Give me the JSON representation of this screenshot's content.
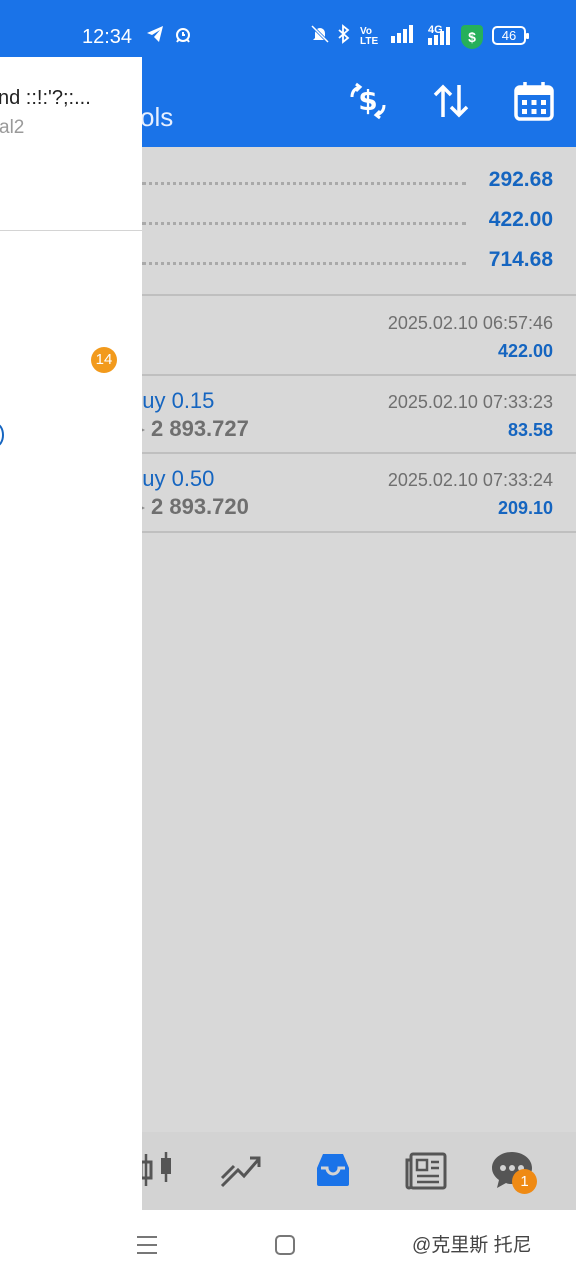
{
  "status_bar": {
    "time": "12:34",
    "network_label": "4G",
    "volte_label": "Vo LTE",
    "battery": "46",
    "shield_glyph": "$"
  },
  "header": {
    "title_fragment": "ols",
    "icons": [
      "currency-exchange-icon",
      "sort-icon",
      "calendar-icon"
    ]
  },
  "summary": {
    "rows": [
      {
        "value": "292.68"
      },
      {
        "value": "422.00"
      },
      {
        "value": "714.68"
      }
    ]
  },
  "deals": [
    {
      "title": "",
      "price": "",
      "date": "2025.02.10 06:57:46",
      "amount": "422.00"
    },
    {
      "title": "buy 0.15",
      "price": "2 893.727",
      "date": "2025.02.10 07:33:23",
      "amount": "83.58"
    },
    {
      "title": "buy 0.50",
      "price": "2 893.720",
      "date": "2025.02.10 07:33:24",
      "amount": "209.10"
    }
  ],
  "bottom_nav": {
    "items": [
      "chart-candles-icon",
      "trade-icon",
      "history-inbox-icon",
      "news-icon",
      "chat-icon"
    ],
    "chat_badge": "1"
  },
  "drawer": {
    "account_name": "nd ::!:'?;:...",
    "server": "al2",
    "mail_badge": "14"
  },
  "system_nav": {
    "watermark": "@克里斯 托尼"
  },
  "colors": {
    "primary": "#1a73e8",
    "value_blue": "#1565c0",
    "badge_orange": "#f29a1c"
  }
}
